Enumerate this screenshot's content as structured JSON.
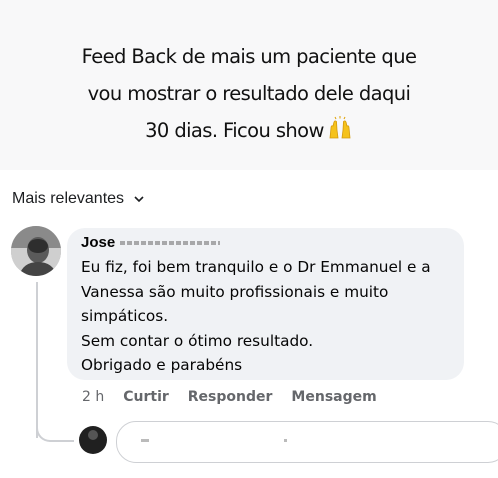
{
  "caption": {
    "lines": [
      "Feed Back de mais um paciente que",
      "vou mostrar o resultado dele daqui",
      "30 dias. Ficou show"
    ],
    "emoji": "raising-hands-emoji"
  },
  "sort": {
    "label": "Mais relevantes",
    "icon": "chevron-down-icon"
  },
  "comment": {
    "author": "Jose",
    "lines": [
      "Eu fiz, foi bem tranquilo e o Dr Emmanuel e a",
      "Vanessa são muito profissionais e muito",
      "simpáticos.",
      "Sem contar o ótimo resultado.",
      "Obrigado e parabéns"
    ],
    "time": "2 h",
    "actions": [
      "Curtir",
      "Responder",
      "Mensagem"
    ]
  },
  "colors": {
    "bubble": "#f0f2f5",
    "secondary_text": "#65676b",
    "emoji": "#f5c21b"
  }
}
